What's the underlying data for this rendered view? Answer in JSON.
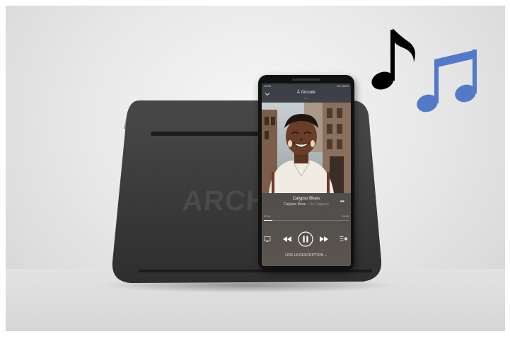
{
  "speaker": {
    "brand_text": "ARCH"
  },
  "phone": {
    "status": {
      "time": "12:00",
      "right": "4G 100%"
    },
    "header": {
      "title": "À l'écoute",
      "subtitle": "• • •"
    },
    "track": {
      "title": "Calypso Blues",
      "artist": "Calypso Rose",
      "album": "– So Calypso!",
      "progress": 0.1
    },
    "time_elapsed": "00:11",
    "time_total": "03:29",
    "description_link": "LIRE LA DESCRIPTION"
  },
  "colors": {
    "speaker_body": "#3b3b3b",
    "note_black": "#000000",
    "note_blue": "#5479c7"
  },
  "icons": [
    "chevron-down-icon",
    "more-icon",
    "cast-icon",
    "rewind-icon",
    "pause-icon",
    "fast-forward-icon",
    "queue-icon",
    "music-note-icon",
    "beamed-notes-icon"
  ]
}
